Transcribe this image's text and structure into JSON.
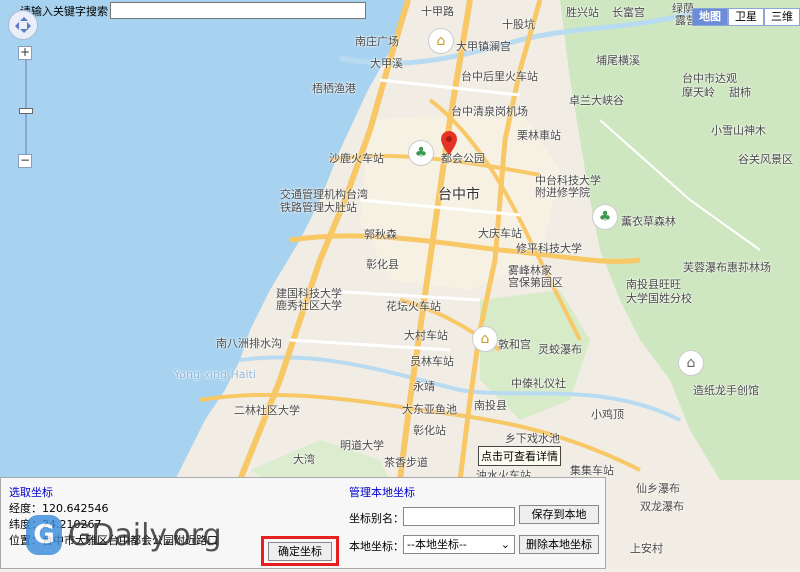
{
  "toolbar": {
    "search_label": "请输入关键字搜索",
    "search_value": ""
  },
  "map_types": [
    "地图",
    "卫星",
    "三维"
  ],
  "map_labels": [
    "十甲路",
    "十股坑",
    "胜兴站",
    "长富宫",
    "绿荫",
    "露营区",
    "南庄广场",
    "大甲镇澜宫",
    "大甲溪",
    "台中后里火车站",
    "埔尾横溪",
    "梧栖渔港",
    "台中清泉岗机场",
    "卓兰大峡谷",
    "台中市达观",
    "摩天岭",
    "甜柿",
    "栗林車站",
    "小雪山神木",
    "沙鹿火车站",
    "都会公园",
    "谷关风景区",
    "交通管理机构台湾",
    "铁路管理大肚站",
    "台中市",
    "中台科技大学",
    "附进修学院",
    "薰衣草森林",
    "郭秋森",
    "大庆车站",
    "修平科技大学",
    "彰化县",
    "雾峰林家",
    "宫保第园区",
    "芙蓉瀑布",
    "惠荪林场",
    "建国科技大学",
    "鹿秀社区大学",
    "南投县旺旺",
    "大学国姓分校",
    "花坛火车站",
    "南八洲排水沟",
    "大村车站",
    "敦和宫",
    "灵蛟瀑布",
    "员林车站",
    "Yong xing Haiti",
    "中傣礼仪社",
    "永靖",
    "造纸龙手创馆",
    "二林社区大学",
    "大东亚鱼池",
    "南投县",
    "小鸡顶",
    "明道大学",
    "彰化站",
    "乡下戏水池",
    "大湾",
    "茶香步道",
    "浊水火车站",
    "集集车站",
    "仙乡瀑布",
    "双龙瀑布",
    "上安村"
  ],
  "marker_tooltip": "点击可查看详情",
  "panel": {
    "pick_title": "选取坐标",
    "longitude_label": "经度：",
    "longitude_value": "120.642546",
    "latitude_label": "纬度：",
    "latitude_value": "24.210267",
    "address_label": "位置：",
    "address_value": "台中市大雅区台中都会公园附近路口",
    "confirm_button": "确定坐标",
    "manage_title": "管理本地坐标",
    "alias_label": "坐标别名：",
    "alias_value": "",
    "save_button": "保存到本地",
    "local_label": "本地坐标：",
    "local_select": "--本地坐标--",
    "delete_button": "删除本地坐标"
  },
  "watermark": {
    "logo": "G",
    "text": "GDaily.org"
  },
  "colors": {
    "sea": "#a8d3f0",
    "land": "#f1ede4",
    "green": "#cfe7c1",
    "road_major": "#f8c766",
    "road_minor": "#ffffff",
    "pin": "#e63325"
  }
}
